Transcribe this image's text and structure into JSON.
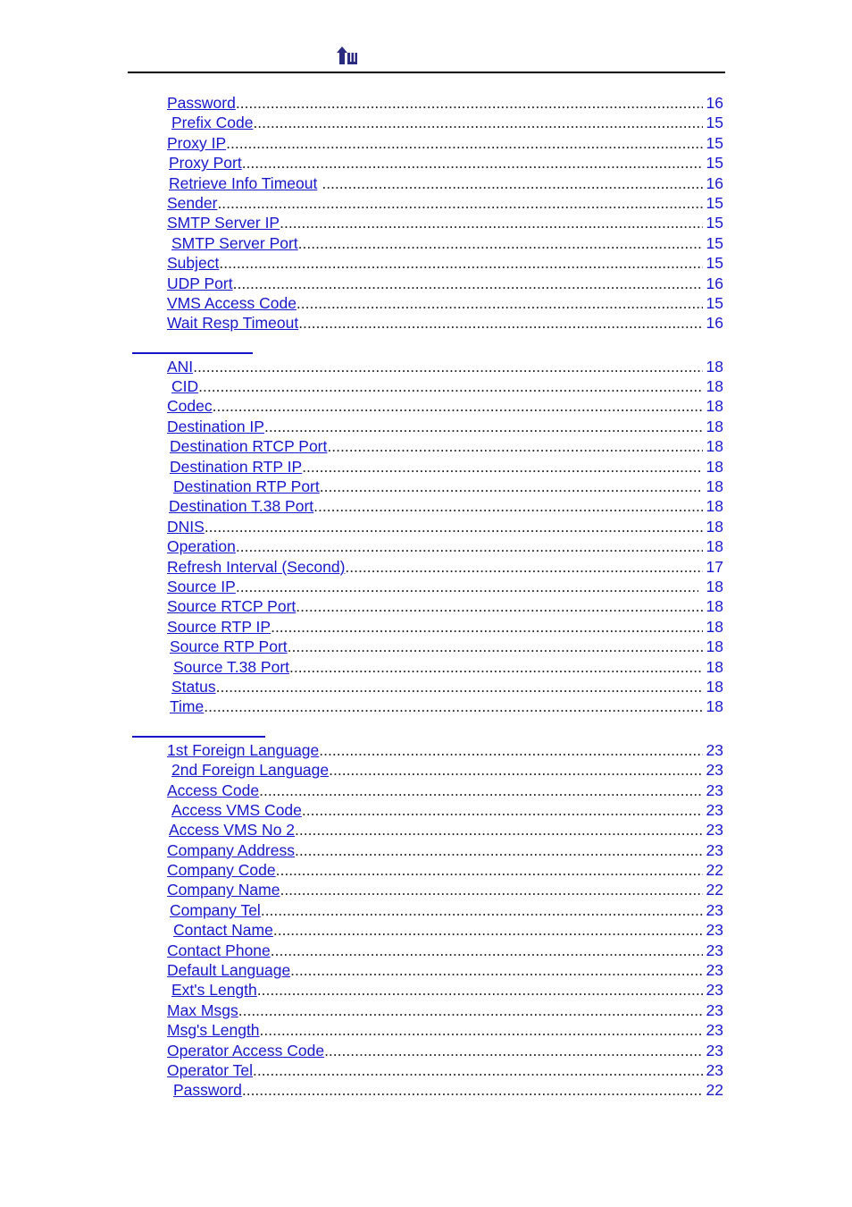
{
  "document": {
    "header": {
      "logo_icon": "up-arrow-w-logo",
      "logo_color": "#2b2b7f",
      "rule_color": "#000000"
    },
    "link_color": "#1818cc",
    "dot_leader_color": "#222222",
    "section_rule_color": "#1515c8"
  },
  "blocks": [
    {
      "id": "block-1",
      "has_rule": false,
      "entries": [
        {
          "label": "Password",
          "page": "16",
          "indent": 0
        },
        {
          "label": "Prefix Code",
          "page": "15",
          "indent": 5
        },
        {
          "label": "Proxy IP",
          "page": "15",
          "indent": 0
        },
        {
          "label": "Proxy Port",
          "page": "15",
          "indent": 2
        },
        {
          "label": "Retrieve Info Timeout",
          "page": "16",
          "indent": 2,
          "gap": true
        },
        {
          "label": "Sender",
          "page": "15",
          "indent": 0
        },
        {
          "label": "SMTP Server IP",
          "page": "15",
          "indent": 0
        },
        {
          "label": "SMTP Server Port",
          "page": "15",
          "indent": 5
        },
        {
          "label": "Subject",
          "page": "15",
          "indent": 0
        },
        {
          "label": "UDP Port",
          "page": "16",
          "indent": 0
        },
        {
          "label": "VMS Access Code",
          "page": "15",
          "indent": 0
        },
        {
          "label": "Wait Resp Timeout",
          "page": "16",
          "indent": 0
        }
      ]
    },
    {
      "id": "block-2",
      "has_rule": true,
      "rule_width": "w1",
      "entries": [
        {
          "label": "ANI",
          "page": "18",
          "indent": 0
        },
        {
          "label": "CID",
          "page": "18",
          "indent": 5
        },
        {
          "label": "Codec",
          "page": "18",
          "indent": 0
        },
        {
          "label": "Destination IP",
          "page": "18",
          "indent": 0
        },
        {
          "label": "Destination RTCP Port",
          "page": "18",
          "indent": 3
        },
        {
          "label": "Destination RTP IP",
          "page": "18",
          "indent": 3
        },
        {
          "label": "Destination RTP Port",
          "page": "18",
          "indent": 7
        },
        {
          "label": "Destination T.38 Port",
          "page": "18",
          "indent": 2
        },
        {
          "label": "DNIS",
          "page": "18",
          "indent": 0
        },
        {
          "label": "Operation",
          "page": "18",
          "indent": 0
        },
        {
          "label": "Refresh Interval (Second)",
          "page": "17",
          "indent": 0
        },
        {
          "label": "Source IP",
          "page": "18",
          "indent": 0,
          "page_pad": true
        },
        {
          "label": "Source RTCP Port",
          "page": "18",
          "indent": 0
        },
        {
          "label": "Source RTP IP",
          "page": "18",
          "indent": 0
        },
        {
          "label": "Source RTP Port",
          "page": "18",
          "indent": 3
        },
        {
          "label": "Source T.38 Port",
          "page": "18",
          "indent": 7
        },
        {
          "label": "Status",
          "page": "18",
          "indent": 5
        },
        {
          "label": "Time",
          "page": "18",
          "indent": 3
        }
      ]
    },
    {
      "id": "block-3",
      "has_rule": true,
      "rule_width": "w2",
      "entries": [
        {
          "label": "1st Foreign Language",
          "page": "23",
          "indent": 0
        },
        {
          "label": "2nd Foreign Language",
          "page": "23",
          "indent": 5
        },
        {
          "label": "Access Code",
          "page": "23",
          "indent": 0
        },
        {
          "label": "Access VMS Code",
          "page": "23",
          "indent": 5
        },
        {
          "label": "Access VMS No 2",
          "page": "23",
          "indent": 2
        },
        {
          "label": "Company Address",
          "page": "23",
          "indent": 0
        },
        {
          "label": "Company Code",
          "page": "22",
          "indent": 0
        },
        {
          "label": "Company Name",
          "page": "22",
          "indent": 0
        },
        {
          "label": "Company Tel",
          "page": "23",
          "indent": 3
        },
        {
          "label": "Contact Name",
          "page": "23",
          "indent": 7
        },
        {
          "label": "Contact Phone",
          "page": "23",
          "indent": 0
        },
        {
          "label": "Default Language",
          "page": "23",
          "indent": 0
        },
        {
          "label": "Ext's Length",
          "page": "23",
          "indent": 5
        },
        {
          "label": "Max Msgs",
          "page": "23",
          "indent": 0
        },
        {
          "label": "Msg's Length",
          "page": "23",
          "indent": 0
        },
        {
          "label": "Operator Access Code",
          "page": "23",
          "indent": 0
        },
        {
          "label": "Operator Tel",
          "page": "23",
          "indent": 0
        },
        {
          "label": "Password",
          "page": "22",
          "indent": 7
        }
      ]
    }
  ]
}
